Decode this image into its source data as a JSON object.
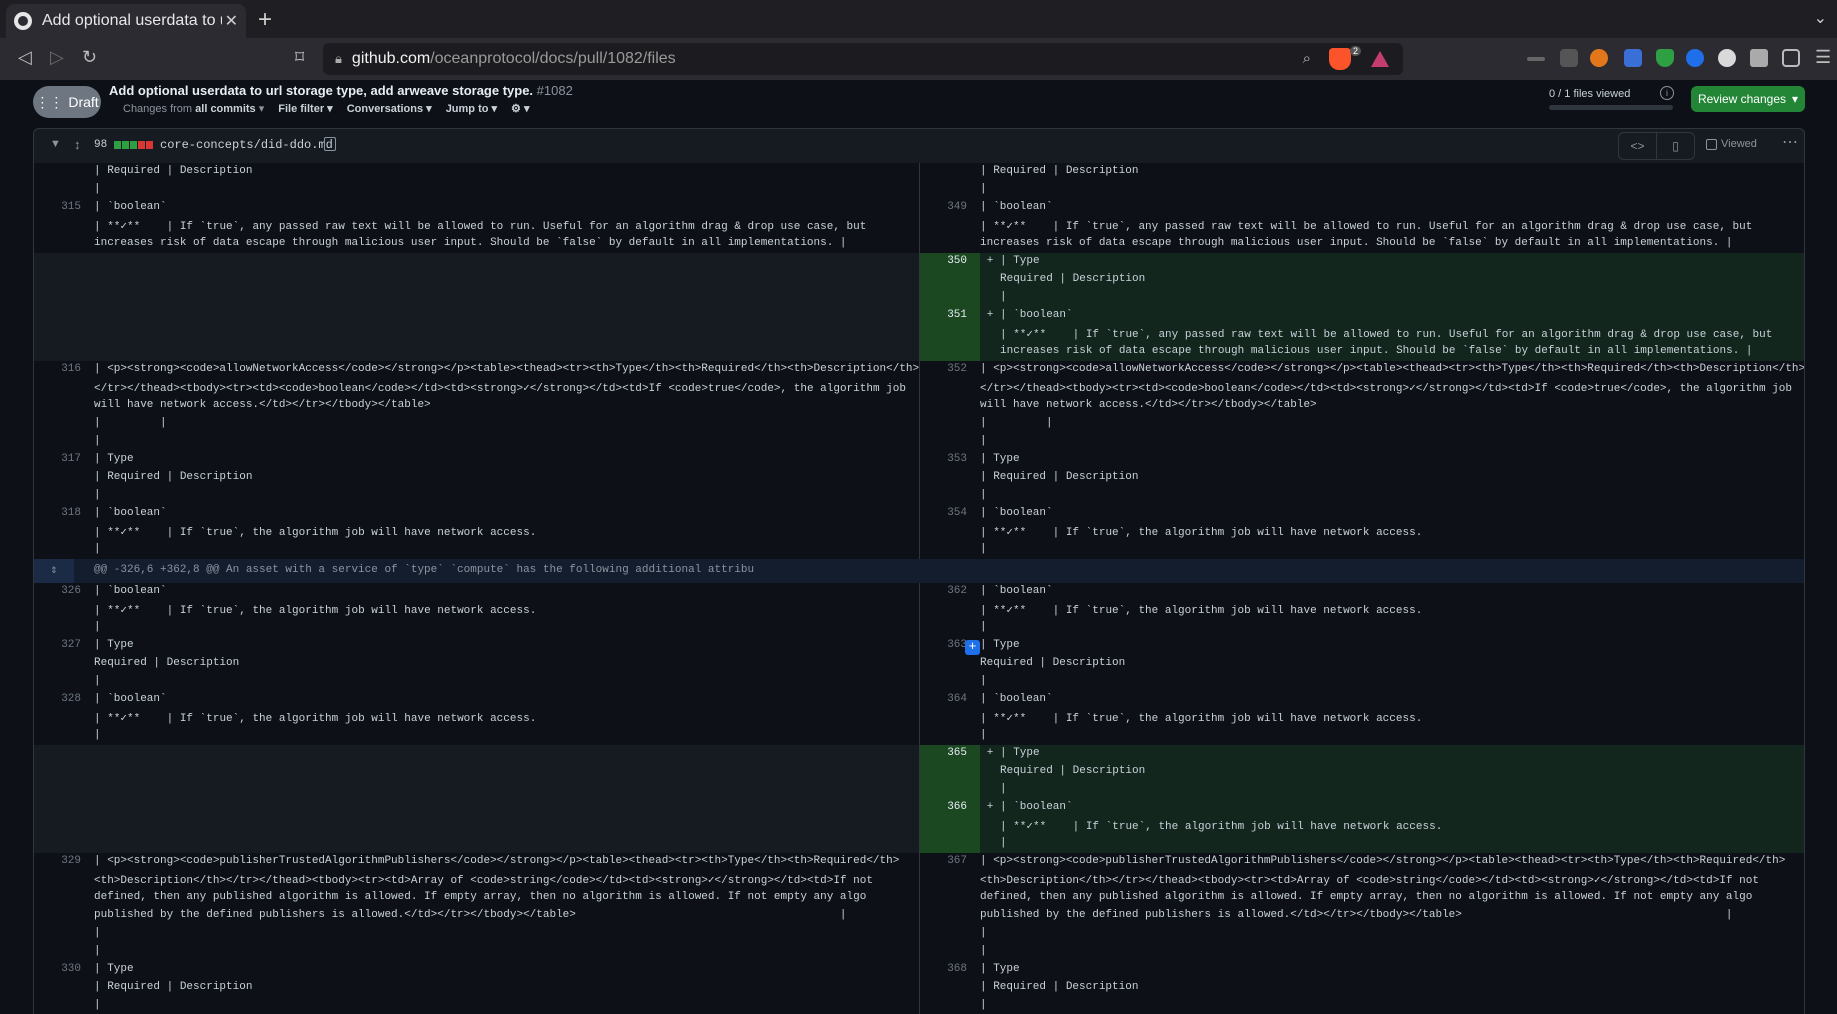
{
  "browser": {
    "tab_title": "Add optional userdata to url storage type, add arweave storage type",
    "tab_close": "✕",
    "new_tab": "+",
    "url_host": "github.com",
    "url_path": "/oceanprotocol/docs/pull/1082/files",
    "brave_count": "2"
  },
  "pr": {
    "draft_label": "Draft",
    "title": "Add optional userdata to url storage type, add arweave storage type.",
    "number": "#1082",
    "changes_from_prefix": "Changes from",
    "changes_from_value": "all commits",
    "file_filter": "File filter",
    "conversations": "Conversations",
    "jump_to": "Jump to",
    "files_viewed": "0 / 1 files viewed",
    "review_changes": "Review changes"
  },
  "file": {
    "changes": "98",
    "path": "core-concepts/did-ddo.md",
    "viewed_label": "Viewed"
  },
  "diff": {
    "blocks": [
      {
        "type": "context",
        "ln": "",
        "rn": "",
        "lines": [
          "| Required | Description",
          "|"
        ]
      },
      {
        "type": "context",
        "ln": "315",
        "rn": "349",
        "lines": [
          "| `boolean`",
          "| **✓**    | If `true`, any passed raw text will be allowed to run. Useful for an algorithm drag & drop use case, but",
          "increases risk of data escape through malicious user input. Should be `false` by default in all implementations. |"
        ]
      },
      {
        "type": "add",
        "rn": "350",
        "lines": [
          "| Type",
          "Required | Description",
          "|"
        ]
      },
      {
        "type": "add",
        "rn": "351",
        "lines": [
          "| `boolean`",
          "| **✓**    | If `true`, any passed raw text will be allowed to run. Useful for an algorithm drag & drop use case, but",
          "increases risk of data escape through malicious user input. Should be `false` by default in all implementations. |"
        ]
      },
      {
        "type": "context",
        "ln": "316",
        "rn": "352",
        "lines": [
          "| <p><strong><code>allowNetworkAccess</code></strong></p><table><thead><tr><th>Type</th><th>Required</th><th>Description</th>",
          "</tr></thead><tbody><tr><td><code>boolean</code></td><td><strong>✓</strong></td><td>If <code>true</code>, the algorithm job",
          "will have network access.</td></tr></tbody></table>",
          "|         |",
          "|"
        ]
      },
      {
        "type": "context",
        "ln": "317",
        "rn": "353",
        "lines": [
          "| Type",
          "| Required | Description",
          "|"
        ]
      },
      {
        "type": "context",
        "ln": "318",
        "rn": "354",
        "lines": [
          "| `boolean`",
          "| **✓**    | If `true`, the algorithm job will have network access.",
          "|"
        ]
      },
      {
        "type": "hunk",
        "text": "@@ -326,6 +362,8 @@ An asset with a service of `type` `compute` has the following additional attribu"
      },
      {
        "type": "context",
        "ln": "326",
        "rn": "362",
        "lines": [
          "| `boolean`",
          "| **✓**    | If `true`, the algorithm job will have network access.",
          "|"
        ]
      },
      {
        "type": "context",
        "ln": "327",
        "rn": "363",
        "comment": true,
        "lines": [
          "| Type",
          "Required | Description",
          "|"
        ]
      },
      {
        "type": "context",
        "ln": "328",
        "rn": "364",
        "lines": [
          "| `boolean`",
          "| **✓**    | If `true`, the algorithm job will have network access.",
          "|"
        ]
      },
      {
        "type": "add",
        "rn": "365",
        "lines": [
          "| Type",
          "Required | Description",
          "|"
        ]
      },
      {
        "type": "add",
        "rn": "366",
        "lines": [
          "| `boolean`",
          "| **✓**    | If `true`, the algorithm job will have network access.",
          "|"
        ]
      },
      {
        "type": "context",
        "ln": "329",
        "rn": "367",
        "lines": [
          "| <p><strong><code>publisherTrustedAlgorithmPublishers</code></strong></p><table><thead><tr><th>Type</th><th>Required</th>",
          "<th>Description</th></tr></thead><tbody><tr><td>Array of <code>string</code></td><td><strong>✓</strong></td><td>If not",
          "defined, then any published algorithm is allowed. If empty array, then no algorithm is allowed. If not empty any algo",
          "published by the defined publishers is allowed.</td></tr></tbody></table>                                        |",
          "|",
          "|"
        ]
      },
      {
        "type": "context",
        "ln": "330",
        "rn": "368",
        "lines": [
          "| Type",
          "| Required | Description",
          "|"
        ]
      }
    ]
  }
}
